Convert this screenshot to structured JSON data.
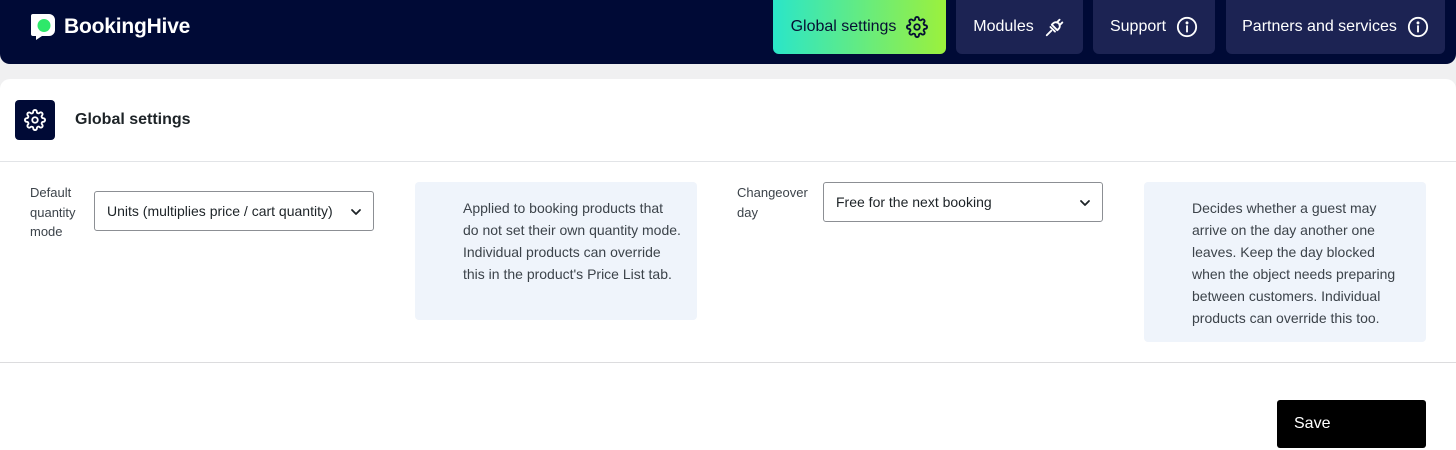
{
  "brand": {
    "name": "BookingHive",
    "logo_icon": "speech-bubble-logo",
    "logo_color": "#2ee86a"
  },
  "nav": {
    "items": [
      {
        "label": "Global settings",
        "icon": "gear-icon",
        "active": true
      },
      {
        "label": "Modules",
        "icon": "plug-icon",
        "active": false
      },
      {
        "label": "Support",
        "icon": "info-icon",
        "active": false
      },
      {
        "label": "Partners and services",
        "icon": "info-icon",
        "active": false
      }
    ]
  },
  "page": {
    "title": "Global settings",
    "title_icon": "gear-icon"
  },
  "fields": {
    "quantity_mode": {
      "label": "Default quantity mode",
      "value": "Units (multiplies price / cart quantity)",
      "help": "Applied to booking products that do not set their own quantity mode. Individual products can override this in the product's Price List tab."
    },
    "changeover": {
      "label": "Changeover day",
      "value": "Free for the next booking",
      "help": "Decides whether a guest may arrive on the day another one leaves. Keep the day blocked when the object needs preparing between customers. Individual products can override this too."
    }
  },
  "actions": {
    "save_label": "Save"
  },
  "colors": {
    "nav_background": "#000a36",
    "nav_button": "#1c2353",
    "active_gradient_start": "#2ae6c9",
    "active_gradient_end": "#9cf03c",
    "help_background": "#eff4fb",
    "save_background": "#000000"
  }
}
